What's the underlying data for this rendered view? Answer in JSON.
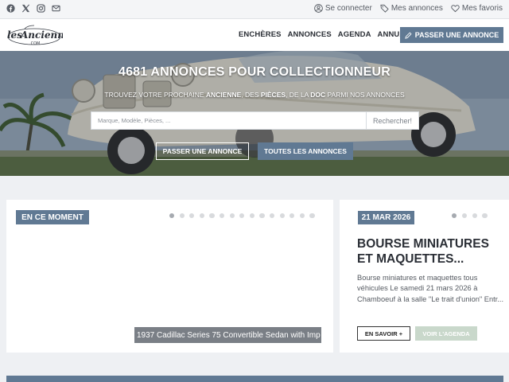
{
  "topbar": {
    "social_icons": [
      "facebook-icon",
      "x-icon",
      "instagram-icon",
      "mail-icon"
    ],
    "links": [
      {
        "icon": "user-icon",
        "label": "Se connecter"
      },
      {
        "icon": "tag-icon",
        "label": "Mes annonces"
      },
      {
        "icon": "heart-icon",
        "label": "Mes favoris"
      }
    ]
  },
  "nav": {
    "menu": [
      "ENCHÈRES",
      "ANNONCES",
      "AGENDA",
      "ANNUAIRE"
    ],
    "post_button": "PASSER UNE ANNONCE"
  },
  "hero": {
    "title": "4681 ANNONCES POUR COLLECTIONNEUR",
    "subtitle_parts": [
      "TROUVEZ VOTRE PROCHAINE ",
      "ANCIENNE",
      ", DES ",
      "PIÈCES",
      ", DE LA ",
      "DOC",
      " PARMI NOS ANNONCES"
    ],
    "search_placeholder": "Marque, Modèle, Pièces, ...",
    "search_button": "Rechercher!",
    "button_post": "PASSER UNE ANNONCE",
    "button_all": "TOUTES LES ANNONCES"
  },
  "current": {
    "tag": "EN CE MOMENT",
    "caption": "1937 Cadillac Series 75 Convertible Sedan with Imp",
    "dot_count": 15,
    "active_dot": 0
  },
  "event": {
    "date": "21 MAR 2026",
    "title": "BOURSE MINIATURES ET MAQUETTES...",
    "description": "Bourse miniatures et maquettes tous véhicules Le samedi 21 mars 2026 à Chamboeuf à la salle \"Le trait d'union\" Entr...",
    "more_button": "EN SAVOIR +",
    "agenda_button": "VOIR L'AGENDA",
    "dot_count": 4,
    "active_dot": 0
  },
  "colors": {
    "accent": "#607993",
    "agenda_button": "#c9d8cb"
  }
}
